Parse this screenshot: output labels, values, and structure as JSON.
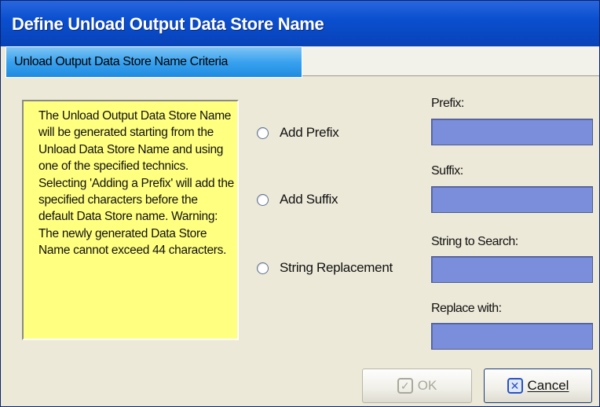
{
  "window": {
    "title": "Define Unload Output Data Store Name"
  },
  "tabs": [
    {
      "label": "Unload Output Data Store Name Criteria",
      "active": true
    }
  ],
  "help_text": "The Unload Output Data Store Name will be generated starting from the Unload Data Store Name and using one of the specified technics. Selecting 'Adding a Prefix' will add the specified characters before the default Data Store name. Warning: The newly generated Data Store Name cannot exceed 44 characters.",
  "options": [
    {
      "label": "Add Prefix",
      "selected": false
    },
    {
      "label": "Add Suffix",
      "selected": false
    },
    {
      "label": "String Replacement",
      "selected": false
    }
  ],
  "fields": {
    "prefix_label": "Prefix:",
    "prefix_value": "",
    "suffix_label": "Suffix:",
    "suffix_value": "",
    "search_label": "String to Search:",
    "search_value": "",
    "replace_label": "Replace with:",
    "replace_value": ""
  },
  "buttons": {
    "ok_label": "OK",
    "ok_enabled": false,
    "cancel_label": "Cancel"
  },
  "colors": {
    "titlebar": "#0a4fcf",
    "tab_active": "#39a2ef",
    "help_background": "#ffff80",
    "input_background": "#7b8edb",
    "dialog_background": "#ece9d8"
  },
  "icons": [
    "check-icon",
    "close-icon",
    "radio-icon"
  ]
}
